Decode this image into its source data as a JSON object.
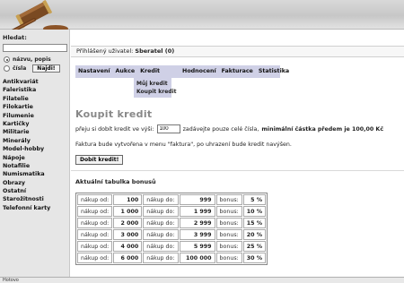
{
  "sidebar": {
    "search_label": "Hledat:",
    "search_value": "",
    "radio_title_label": "názvu, popis",
    "radio_number_label": "čísla",
    "find_button": "Najdi!",
    "categories": [
      "Antikvariát",
      "Faleristika",
      "Filatelie",
      "Filokartie",
      "Filumenie",
      "Kartičky",
      "Militarie",
      "Minerály",
      "Model-hobby",
      "Nápoje",
      "Notafilie",
      "Numismatika",
      "Obrazy",
      "Ostatní",
      "Starožitnosti",
      "Telefonní karty"
    ]
  },
  "userbar": {
    "prefix": "Přihlášený uživatel:",
    "user": "Sberatel (0)"
  },
  "menu": {
    "items": [
      "Nastavení",
      "Aukce",
      "Kredit",
      "Hodnocení",
      "Fakturace",
      "Statistika"
    ],
    "submenu": [
      "Můj kredit",
      "Koupit kredit"
    ]
  },
  "main": {
    "title": "Koupit kredit",
    "credit_prefix": "přeju si dobít kredit ve výši:",
    "credit_value": "100",
    "credit_hint": "zadávejte pouze celé čísla,",
    "credit_min": "minimální částka předem je 100,00 Kč",
    "invoice_note": "Faktura bude vytvořena v menu \"faktura\", po uhrazení bude kredit navýšen.",
    "buy_button": "Dobít kredit!",
    "table_title": "Aktuální tabulka bonusů"
  },
  "bonus_table": {
    "label_from": "nákup od:",
    "label_to": "nákup do:",
    "label_bonus": "bonus:",
    "rows": [
      {
        "from": "100",
        "to": "999",
        "bonus": "5 %"
      },
      {
        "from": "1 000",
        "to": "1 999",
        "bonus": "10 %"
      },
      {
        "from": "2 000",
        "to": "2 999",
        "bonus": "15 %"
      },
      {
        "from": "3 000",
        "to": "3 999",
        "bonus": "20 %"
      },
      {
        "from": "4 000",
        "to": "5 999",
        "bonus": "25 %"
      },
      {
        "from": "6 000",
        "to": "100 000",
        "bonus": "30 %"
      }
    ]
  },
  "statusbar": {
    "text": "Hotovo"
  },
  "colors": {
    "menu_bg": "#cfd0e6",
    "title_gray": "#888888"
  }
}
